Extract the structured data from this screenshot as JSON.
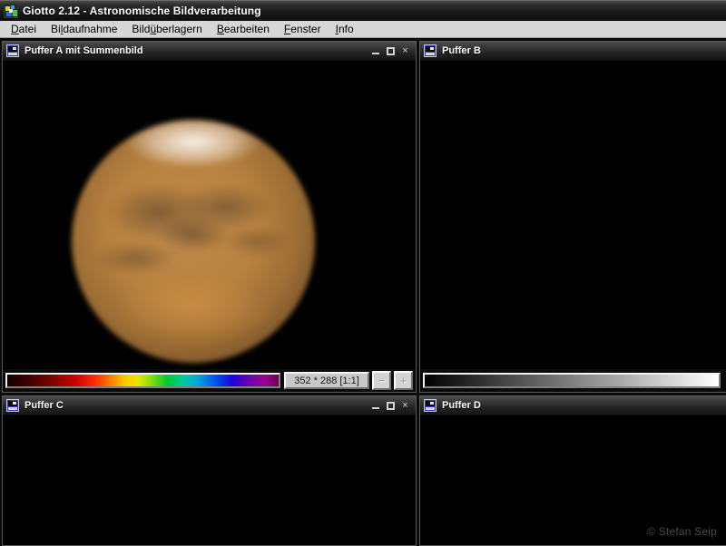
{
  "window": {
    "title": "Giotto 2.12 - Astronomische Bildverarbeitung",
    "app_icon": "giotto-app-icon",
    "titlebar_color": "#2a2a2a"
  },
  "menubar": {
    "items": [
      {
        "label": "Datei",
        "accel": "D",
        "accel_index": 0
      },
      {
        "label": "Bildaufnahme",
        "accel": "l",
        "accel_index": 2
      },
      {
        "label": "Bildüberlagern",
        "accel": "ü",
        "accel_index": 4
      },
      {
        "label": "Bearbeiten",
        "accel": "B",
        "accel_index": 0
      },
      {
        "label": "Fenster",
        "accel": "F",
        "accel_index": 0
      },
      {
        "label": "Info",
        "accel": "I",
        "accel_index": 0
      }
    ]
  },
  "buffers": [
    {
      "id": "A",
      "title": "Puffer A mit Summenbild",
      "has_window_buttons": true,
      "content": "mars-planet-image",
      "palette_type": "spectrum",
      "status_label": "352 * 288 [1:1]",
      "zoom_out_label": "−",
      "zoom_in_label": "+"
    },
    {
      "id": "B",
      "title": "Puffer B",
      "has_window_buttons": false,
      "content": "empty",
      "palette_type": "grayscale",
      "status_label": "",
      "zoom_out_label": "−",
      "zoom_in_label": "+"
    },
    {
      "id": "C",
      "title": "Puffer C",
      "has_window_buttons": true,
      "content": "empty",
      "palette_type": "none",
      "status_label": "",
      "zoom_out_label": "−",
      "zoom_in_label": "+"
    },
    {
      "id": "D",
      "title": "Puffer D",
      "has_window_buttons": false,
      "content": "empty",
      "palette_type": "none",
      "status_label": "",
      "zoom_out_label": "−",
      "zoom_in_label": "+"
    }
  ],
  "window_controls": {
    "minimize": "minimize-icon",
    "maximize": "maximize-icon",
    "close": "×"
  },
  "watermark": {
    "text": "© Stefan Seip",
    "color": "#4b4b4b"
  },
  "colors": {
    "menubar_bg": "#d7d7d7",
    "buffer_bg": "#000000",
    "frame": "#5a5a5a",
    "status_box_bg": "#c8c8c8"
  }
}
